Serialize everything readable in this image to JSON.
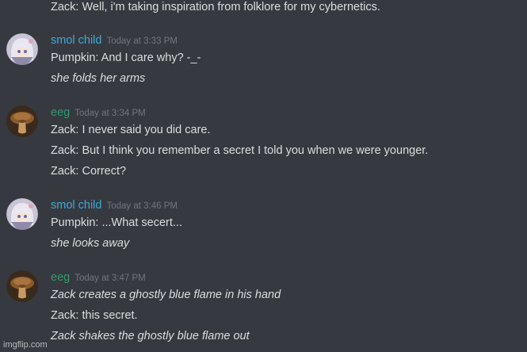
{
  "colors": {
    "background": "#36393f",
    "text": "#dcddde",
    "timestamp": "#72767d",
    "smol_child_name": "#3fa9d8",
    "eeg_name": "#2e9a6f"
  },
  "messages": {
    "top_line": "Zack: Well, i'm taking inspiration from folklore for my cybernetics.",
    "group1": {
      "username": "smol child",
      "timestamp": "Today at 3:33 PM",
      "avatar_icon": "anime-girl-avatar",
      "lines": [
        "Pumpkin: And I care why? -_-",
        "she folds her arms"
      ]
    },
    "group2": {
      "username": "eeg",
      "timestamp": "Today at 3:34 PM",
      "avatar_icon": "mushroom-avatar",
      "lines": [
        "Zack: I never said you did care.",
        "Zack: But I think you remember a secret I told you when we were younger.",
        "Zack: Correct?"
      ]
    },
    "group3": {
      "username": "smol child",
      "timestamp": "Today at 3:46 PM",
      "avatar_icon": "anime-girl-avatar",
      "lines": [
        "Pumpkin:  ...What secert...",
        "she looks away"
      ]
    },
    "group4": {
      "username": "eeg",
      "timestamp": "Today at 3:47 PM",
      "avatar_icon": "mushroom-avatar",
      "lines": [
        "Zack creates a ghostly blue flame in his hand",
        "Zack: this secret.",
        "Zack shakes the ghostly blue flame out"
      ]
    }
  },
  "watermark": "imgflip.com"
}
